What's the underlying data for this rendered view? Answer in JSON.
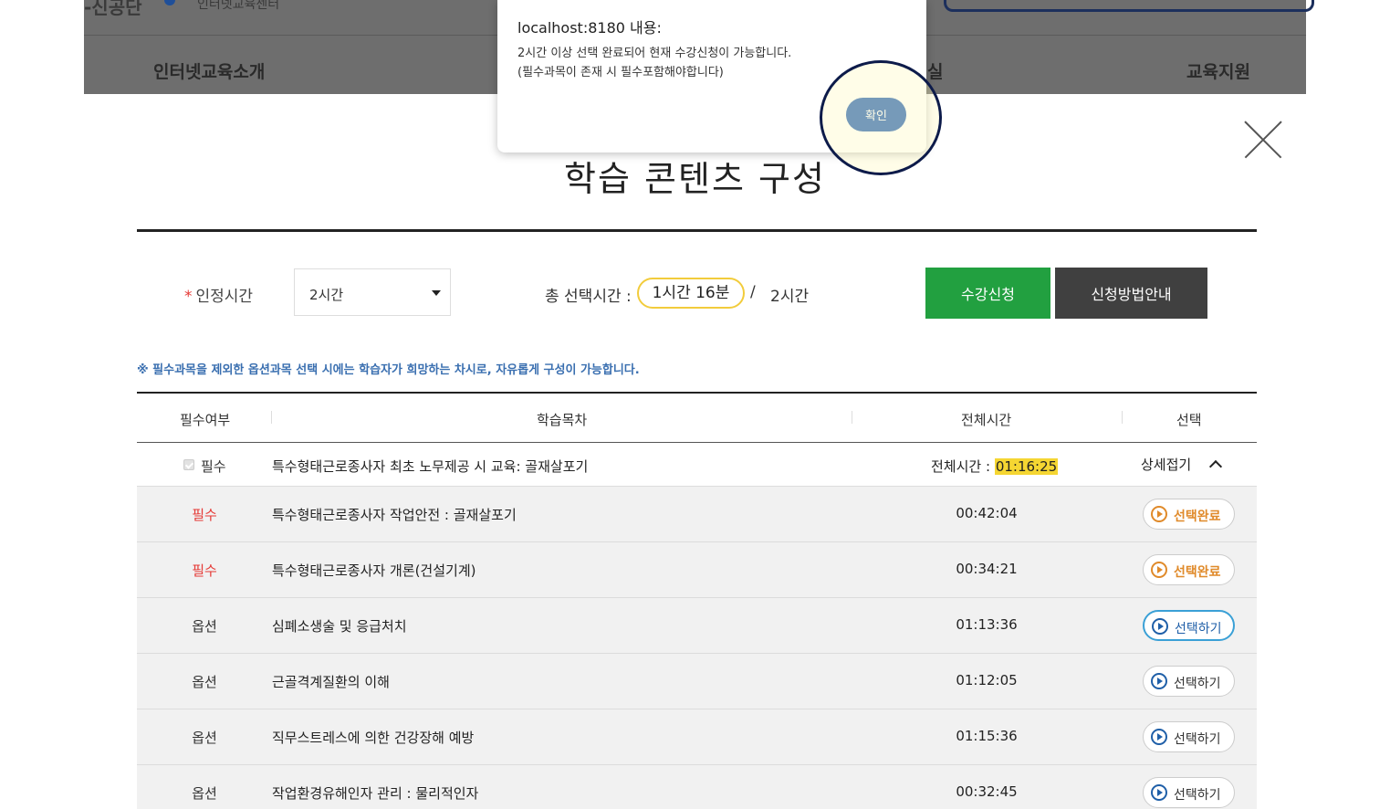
{
  "site": {
    "logo_text": "-신공단",
    "logo_sub": "인터넷교육센터",
    "nav": [
      "인터넷교육소개",
      "실",
      "교육지원"
    ]
  },
  "alert": {
    "title": "localhost:8180 내용:",
    "line1": "2시간 이상 선택 완료되어 현재 수강신청이 가능합니다.",
    "line2": "(필수과목이 존재 시 필수포함해야합니다)",
    "ok_label": "확인"
  },
  "modal": {
    "title": "학습 콘텐츠 구성",
    "required_label": "인정시간",
    "required_star": "*",
    "hours_select": "2시간",
    "total_label": "총 선택시간 :",
    "total_selected": "1시간 16분",
    "total_slash": "/",
    "total_max": "2시간",
    "apply_button": "수강신청",
    "guide_button": "신청방법안내",
    "notice": "※ 필수과목을 제외한 옵션과목 선택 시에는 학습자가 희망하는 차시로, 자유롭게 구성이 가능합니다."
  },
  "table": {
    "headers": [
      "필수여부",
      "학습목차",
      "전체시간",
      "선택"
    ],
    "group": {
      "required": "필수",
      "title": "특수형태근로종사자 최초 노무제공 시 교육: 골재살포기",
      "total_time_label": "전체시간 :",
      "total_time_value": "01:16:25",
      "fold_label": "상세접기"
    },
    "rows": [
      {
        "type": "필수",
        "title": "특수형태근로종사자 작업안전 : 골재살포기",
        "time": "00:42:04",
        "button": "선택완료"
      },
      {
        "type": "필수",
        "title": "특수형태근로종사자 개론(건설기계)",
        "time": "00:34:21",
        "button": "선택완료"
      },
      {
        "type": "옵션",
        "title": "심폐소생술 및 응급처치",
        "time": "01:13:36",
        "button": "선택하기"
      },
      {
        "type": "옵션",
        "title": "근골격계질환의 이해",
        "time": "01:12:05",
        "button": "선택하기"
      },
      {
        "type": "옵션",
        "title": "직무스트레스에 의한 건강장해 예방",
        "time": "01:15:36",
        "button": "선택하기"
      },
      {
        "type": "옵션",
        "title": "작업환경유해인자 관리 : 물리적인자",
        "time": "00:32:45",
        "button": "선택하기"
      }
    ]
  },
  "colors": {
    "apply_green": "#22a040",
    "guide_dark": "#404040",
    "required_red": "#e53935",
    "done_orange": "#e08a2a",
    "select_blue": "#1f5fa8",
    "highlight_yellow": "#f5d632",
    "ok_blue": "#2d67b7"
  }
}
